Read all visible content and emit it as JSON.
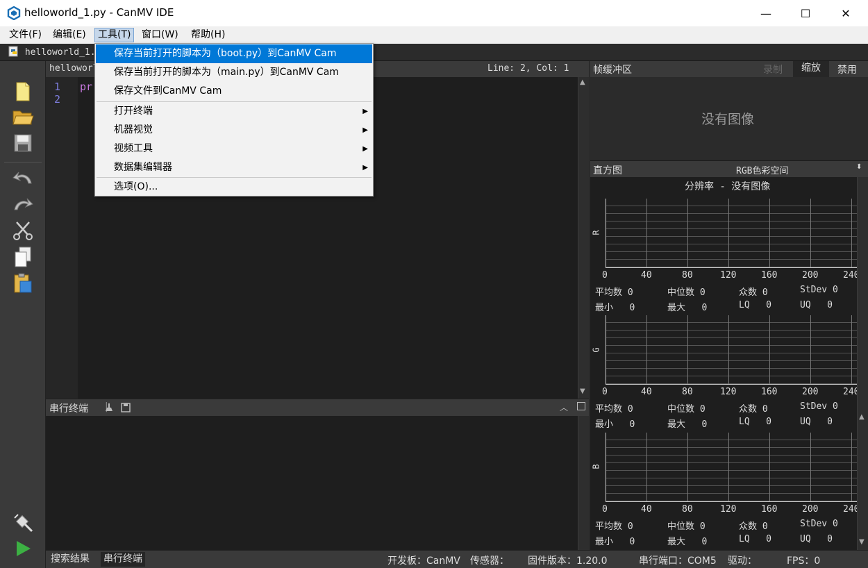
{
  "window": {
    "title": "helloworld_1.py - CanMV IDE",
    "minimize": "—",
    "maximize": "☐",
    "close": "✕"
  },
  "menubar": [
    {
      "label": "文件(F)",
      "active": false
    },
    {
      "label": "编辑(E)",
      "active": false
    },
    {
      "label": "工具(T)",
      "active": true
    },
    {
      "label": "窗口(W)",
      "active": false
    },
    {
      "label": "帮助(H)",
      "active": false
    }
  ],
  "tab": {
    "filename": "helloworld_1.p"
  },
  "editor": {
    "header_filename": "helloworl",
    "position": "Line: 2, Col: 1",
    "lines": [
      "1",
      "2"
    ],
    "code_line1": "pr"
  },
  "dropdown": {
    "items": [
      {
        "label": "保存当前打开的脚本为（boot.py）到CanMV Cam",
        "highlighted": true,
        "submenu": false
      },
      {
        "label": "保存当前打开的脚本为（main.py）到CanMV Cam",
        "highlighted": false,
        "submenu": false
      },
      {
        "label": "保存文件到CanMV Cam",
        "highlighted": false,
        "submenu": false
      },
      {
        "label": "打开终端",
        "highlighted": false,
        "submenu": true
      },
      {
        "label": "机器视觉",
        "highlighted": false,
        "submenu": true
      },
      {
        "label": "视频工具",
        "highlighted": false,
        "submenu": true
      },
      {
        "label": "数据集编辑器",
        "highlighted": false,
        "submenu": true
      },
      {
        "label": "选项(O)...",
        "highlighted": false,
        "submenu": false
      }
    ]
  },
  "serial": {
    "title": "串行终端"
  },
  "framebuffer": {
    "title": "帧缓冲区",
    "record": "录制",
    "zoom": "缩放",
    "disable": "禁用",
    "no_image": "没有图像"
  },
  "histogram": {
    "title": "直方图",
    "colorspace": "RGB色彩空间",
    "resolution": "分辨率 - 没有图像",
    "ticks": [
      "0",
      "40",
      "80",
      "120",
      "160",
      "200",
      "240"
    ],
    "channels": [
      {
        "label": "R"
      },
      {
        "label": "G"
      },
      {
        "label": "B"
      }
    ],
    "stats": {
      "mean": "平均数 0",
      "median": "中位数 0",
      "mode": "众数 0",
      "stdev": "StDev 0",
      "min": "最小   0",
      "max": "最大   0",
      "lq": "LQ   0",
      "uq": "UQ   0"
    }
  },
  "statusbar": {
    "search_results": "搜索结果",
    "serial_terminal": "串行终端",
    "board": "开发板：CanMV",
    "sensor": "传感器：",
    "firmware": "固件版本：1.20.0",
    "port": "串行端口：COM5",
    "driver": "驱动：",
    "fps": "FPS：0"
  },
  "colors": {
    "highlight": "#0078d7",
    "run": "#3cb043"
  }
}
